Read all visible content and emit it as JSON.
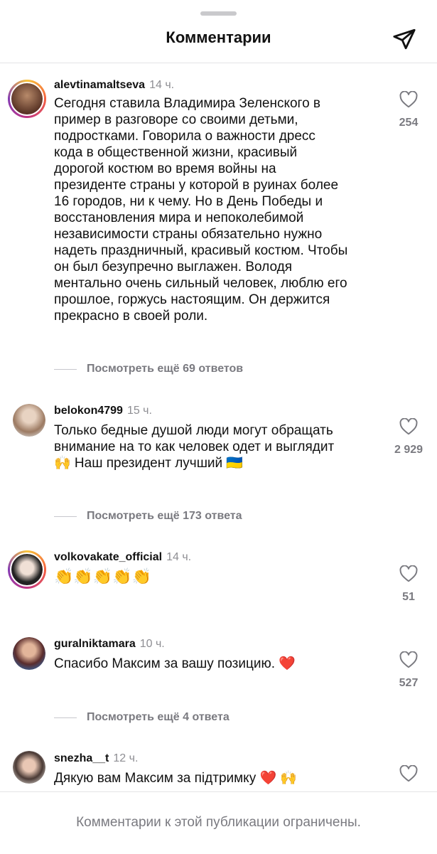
{
  "header": {
    "title": "Комментарии"
  },
  "comments": [
    {
      "username": "alevtinamaltseva",
      "time": "14 ч.",
      "text": "Сегодня ставила Владимира Зеленского в\nпример в разговоре со своими детьми,\nподростками. Говорила о важности дресс\nкода в общественной жизни, красивый\nдорогой костюм во время войны на\nпрезиденте страны у которой в руинах более\n16 городов, ни к чему. Но в День Победы и\nвосстановления мира и непоколебимой\nнезависимости страны обязательно нужно\nнадеть праздничный, красивый костюм. Чтобы\nон был безупречно выглажен. Володя\nментально очень сильный человек, люблю его\nпрошлое, горжусь настоящим. Он держится\nпрекрасно в своей роли.",
      "likes": "254",
      "replies": "Посмотреть ещё 69 ответов"
    },
    {
      "username": "belokon4799",
      "time": "15 ч.",
      "text": "Только бедные душой люди могут обращать\nвнимание на то как человек одет и выглядит\n🙌 Наш президент лучший 🇺🇦",
      "likes": "2 929",
      "replies": "Посмотреть ещё 173 ответа"
    },
    {
      "username": "volkovakate_official",
      "time": "14 ч.",
      "text": "👏👏👏👏👏",
      "likes": "51"
    },
    {
      "username": "guralniktamara",
      "time": "10 ч.",
      "text": "Спасибо Максим за вашу позицию. ❤️",
      "likes": "527",
      "replies": "Посмотреть ещё 4 ответа"
    },
    {
      "username": "snezha__t",
      "time": "12 ч.",
      "text": "Дякую вам Максим за підтримку ❤️ 🙌"
    }
  ],
  "footer": {
    "text": "Комментарии к этой публикации ограничены."
  },
  "colors": {
    "text": "#111111",
    "secondary": "#7a7a80",
    "heart": "#e0245e"
  },
  "icons": {
    "send": "paper-plane-icon",
    "like": "heart-outline-icon"
  }
}
